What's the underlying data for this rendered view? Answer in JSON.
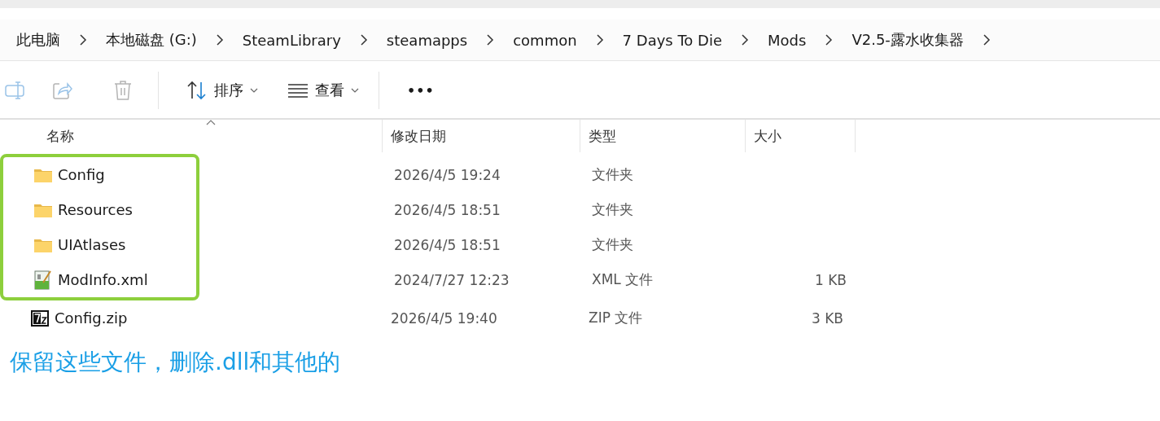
{
  "breadcrumb": [
    "此电脑",
    "本地磁盘 (G:)",
    "SteamLibrary",
    "steamapps",
    "common",
    "7 Days To Die",
    "Mods",
    "V2.5-露水收集器"
  ],
  "toolbar": [
    {
      "kind": "rename",
      "disabled": true
    },
    {
      "kind": "share",
      "disabled": true
    },
    {
      "kind": "delete",
      "disabled": true
    },
    {
      "kind": "divider"
    },
    {
      "kind": "sort",
      "label": "排序",
      "disabled": false
    },
    {
      "kind": "view",
      "label": "查看",
      "disabled": false
    },
    {
      "kind": "divider"
    },
    {
      "kind": "more",
      "label": "•••",
      "disabled": false
    }
  ],
  "table": {
    "columns": [
      {
        "label": "名称",
        "sorted": true
      },
      {
        "label": "修改日期",
        "sorted": false
      },
      {
        "label": "类型",
        "sorted": false
      },
      {
        "label": "大小",
        "sorted": false
      }
    ],
    "rows": [
      {
        "kind": "folder",
        "name": "Config",
        "date": "2026/4/5 19:24",
        "type": "文件夹",
        "marked": true
      },
      {
        "kind": "folder",
        "name": "Resources",
        "date": "2026/4/5 18:51",
        "type": "文件夹",
        "marked": true
      },
      {
        "kind": "folder",
        "name": "UIAtlases",
        "date": "2026/4/5 18:51",
        "type": "文件夹",
        "marked": true
      },
      {
        "kind": "xml",
        "name": "ModInfo.xml",
        "date": "2024/7/27 12:23",
        "type": "XML 文件",
        "size": "1 KB",
        "marked": true
      },
      {
        "kind": "archive",
        "name": "Config.zip",
        "date": "2026/4/5 19:40",
        "type": "ZIP 文件",
        "size": "3 KB",
        "marked": false
      }
    ]
  },
  "note": "保留这些文件，删除.dll和其他的"
}
